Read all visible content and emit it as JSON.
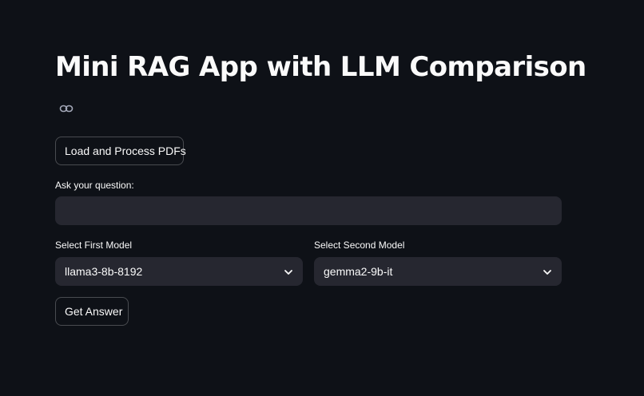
{
  "page": {
    "title": "Mini RAG App with LLM Comparison"
  },
  "actions": {
    "load_label": "Load and Process PDFs",
    "answer_label": "Get Answer"
  },
  "question": {
    "label": "Ask your question:",
    "value": "",
    "placeholder": ""
  },
  "models": {
    "first": {
      "label": "Select First Model",
      "selected": "llama3-8b-8192"
    },
    "second": {
      "label": "Select Second Model",
      "selected": "gemma2-9b-it"
    }
  },
  "icons": {
    "anchor": "link-icon",
    "dropdown": "chevron-down-icon"
  },
  "colors": {
    "background": "#0e1117",
    "input_background": "#262730",
    "text": "#fafafa"
  }
}
